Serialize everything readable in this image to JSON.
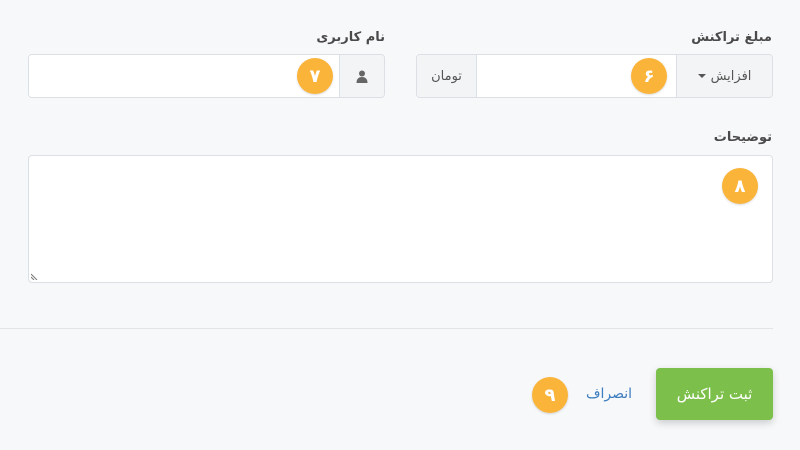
{
  "form": {
    "amount": {
      "label": "مبلغ تراکنش",
      "operation_selected": "افزایش",
      "value": "",
      "unit": "تومان",
      "badge": "۶"
    },
    "username": {
      "label": "نام کاربری",
      "value": "",
      "badge": "۷",
      "icon": "user-icon"
    },
    "description": {
      "label": "توضیحات",
      "value": "",
      "badge": "۸"
    }
  },
  "footer": {
    "submit_label": "ثبت تراکنش",
    "cancel_label": "انصراف",
    "badge": "۹"
  },
  "colors": {
    "badge": "#fbb43a",
    "submit": "#7cc04b",
    "link": "#3c7dbf",
    "divider": "#e2e5e8"
  }
}
